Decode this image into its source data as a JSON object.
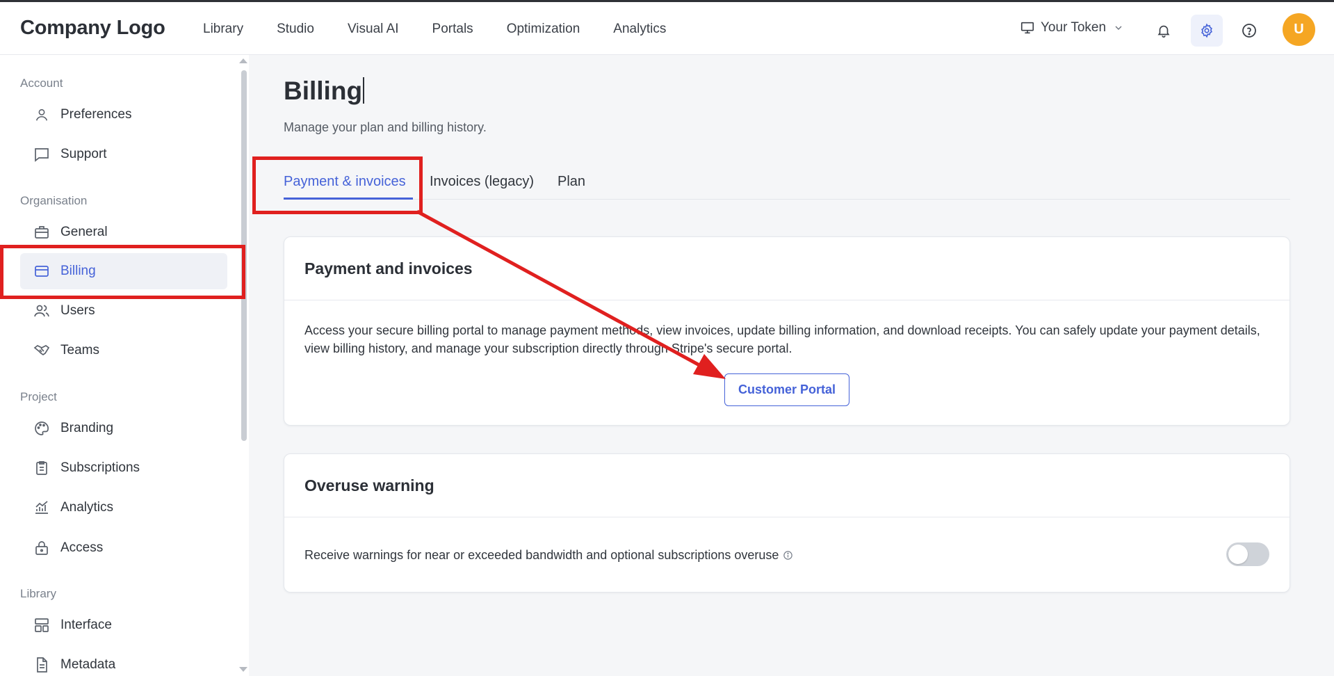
{
  "header": {
    "logo": "Company Logo",
    "nav": [
      "Library",
      "Studio",
      "Visual AI",
      "Portals",
      "Optimization",
      "Analytics"
    ],
    "token_label": "Your Token",
    "avatar_initial": "U"
  },
  "sidebar": {
    "sections": {
      "account": "Account",
      "organisation": "Organisation",
      "project": "Project",
      "library": "Library"
    },
    "items": {
      "preferences": "Preferences",
      "support": "Support",
      "general": "General",
      "billing": "Billing",
      "users": "Users",
      "teams": "Teams",
      "branding": "Branding",
      "subscriptions": "Subscriptions",
      "analytics": "Analytics",
      "access": "Access",
      "interface": "Interface",
      "metadata": "Metadata"
    },
    "active_item": "Billing"
  },
  "main": {
    "title": "Billing",
    "subtitle": "Manage your plan and billing history.",
    "tabs": [
      "Payment & invoices",
      "Invoices (legacy)",
      "Plan"
    ],
    "active_tab": "Payment & invoices",
    "payment_card": {
      "title": "Payment and invoices",
      "text": "Access your secure billing portal to manage payment methods, view invoices, update billing information, and download receipts. You can safely update your payment details, view billing history, and manage your subscription directly through Stripe's secure portal.",
      "button": "Customer Portal"
    },
    "overuse_card": {
      "title": "Overuse warning",
      "text": "Receive warnings for near or exceeded bandwidth and optional subscriptions overuse",
      "toggle_on": false
    }
  },
  "colors": {
    "accent": "#4562d8",
    "annotation": "#e0201f",
    "avatar": "#f5a623"
  }
}
